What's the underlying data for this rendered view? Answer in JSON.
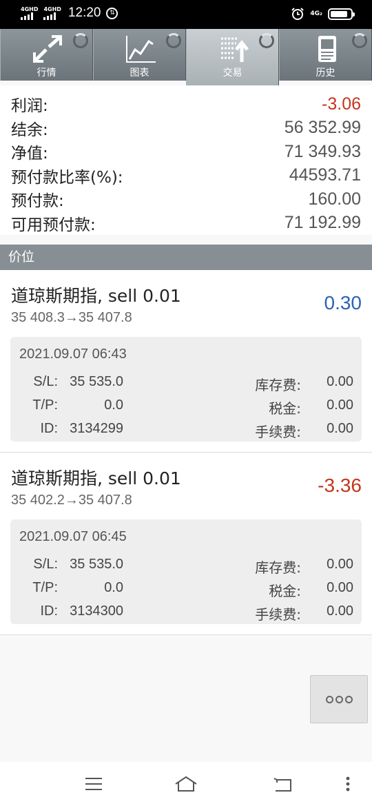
{
  "status_bar": {
    "signal1": "4GHD",
    "signal2": "4GHD",
    "time": "12:20",
    "download_badge": "⇅",
    "network": "4G₂",
    "battery_level": 0.85,
    "icons": [
      "signal-icon",
      "alarm-icon",
      "battery-icon"
    ]
  },
  "tabs": [
    {
      "label": "行情",
      "icon": "quotes-arrows-icon",
      "active": false
    },
    {
      "label": "图表",
      "icon": "chart-line-icon",
      "active": false
    },
    {
      "label": "交易",
      "icon": "trade-list-icon",
      "active": true
    },
    {
      "label": "历史",
      "icon": "history-doc-icon",
      "active": false
    }
  ],
  "summary": {
    "profit_label": "利润:",
    "profit_value": "-3.06",
    "balance_label": "结余:",
    "balance_value": "56 352.99",
    "equity_label": "净值:",
    "equity_value": "71 349.93",
    "margin_level_label": "预付款比率(%):",
    "margin_level_value": "44593.71",
    "margin_label": "预付款:",
    "margin_value": "160.00",
    "free_margin_label": "可用预付款:",
    "free_margin_value": "71 192.99"
  },
  "section_title": "价位",
  "positions": [
    {
      "title": "道琼斯期指, sell 0.01",
      "prices": "35 408.3→35 407.8",
      "profit": "0.30",
      "time": "2021.09.07 06:43",
      "sl_label": "S/L:",
      "sl": "35 535.0",
      "tp_label": "T/P:",
      "tp": "0.0",
      "id_label": "ID:",
      "id": "3134299",
      "swap_label": "库存费:",
      "swap": "0.00",
      "tax_label": "税金:",
      "tax": "0.00",
      "fee_label": "手续费:",
      "fee": "0.00"
    },
    {
      "title": "道琼斯期指, sell 0.01",
      "prices": "35 402.2→35 407.8",
      "profit": "-3.36",
      "time": "2021.09.07 06:45",
      "sl_label": "S/L:",
      "sl": "35 535.0",
      "tp_label": "T/P:",
      "tp": "0.0",
      "id_label": "ID:",
      "id": "3134300",
      "swap_label": "库存费:",
      "swap": "0.00",
      "tax_label": "税金:",
      "tax": "0.00",
      "fee_label": "手续费:",
      "fee": "0.00"
    }
  ],
  "colors": {
    "negative": "#c4351c",
    "positive": "#2a63b6",
    "tabbar": "#7b8489",
    "section": "#878f94"
  },
  "nav": {
    "icons": [
      "menu-icon",
      "home-icon",
      "back-icon",
      "more-vertical-icon"
    ]
  }
}
